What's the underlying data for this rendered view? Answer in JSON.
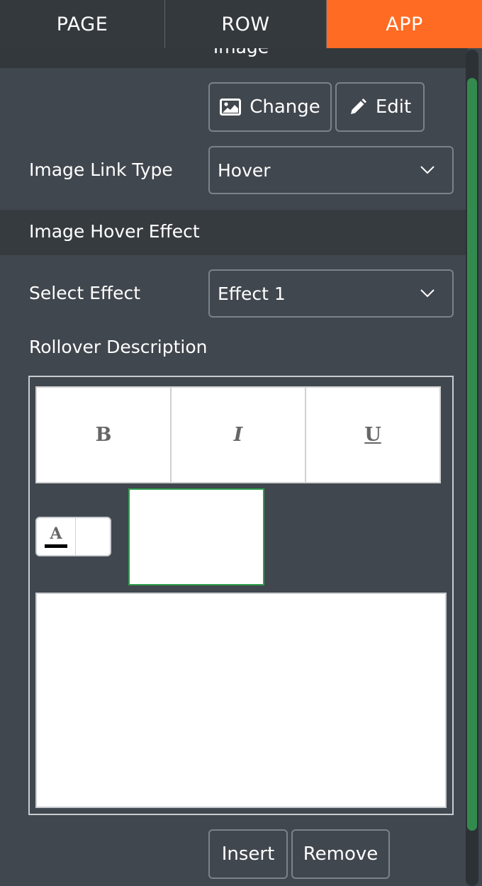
{
  "tabs": [
    {
      "label": "PAGE"
    },
    {
      "label": "ROW"
    },
    {
      "label": "APP",
      "active": true
    }
  ],
  "section_image": {
    "title": "Image"
  },
  "image_buttons": {
    "change": "Change",
    "edit": "Edit"
  },
  "link_type": {
    "label": "Image Link Type",
    "value": "Hover"
  },
  "hover_section": {
    "title": "Image Hover Effect"
  },
  "effect": {
    "label": "Select Effect",
    "value": "Effect 1"
  },
  "rollover": {
    "label": "Rollover Description",
    "format_buttons": [
      "B",
      "I",
      "U"
    ],
    "text_color_glyph": "A",
    "text_value": ""
  },
  "actions": {
    "insert": "Insert",
    "remove": "Remove"
  },
  "colors": {
    "accent": "#ff6b22",
    "panel": "#41474e",
    "scroll": "#338a4e",
    "swatch_border": "#2e9d4c"
  }
}
